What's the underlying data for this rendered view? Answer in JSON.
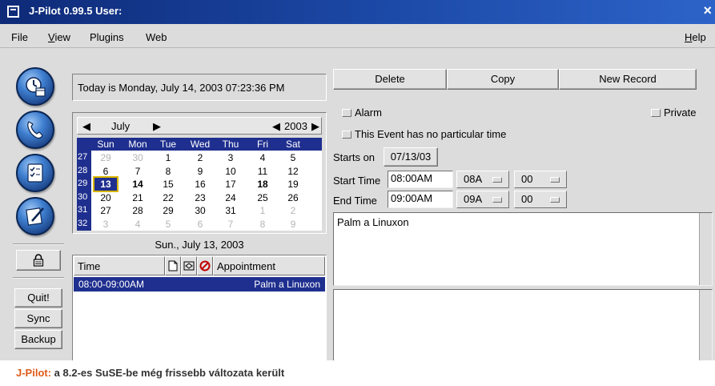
{
  "window": {
    "title": "J-Pilot 0.99.5 User:",
    "close_glyph": "×"
  },
  "menu": {
    "file": "File",
    "view": "View",
    "plugins": "Plugins",
    "web": "Web",
    "help": "Help"
  },
  "sidebar": {
    "icons": [
      "datebook-icon",
      "address-icon",
      "todo-icon",
      "memo-icon"
    ],
    "lock_icon": "lock-icon",
    "buttons": {
      "quit": "Quit!",
      "sync": "Sync",
      "backup": "Backup"
    }
  },
  "calendar": {
    "today_text": "Today is Monday, July 14, 2003 07:23:36 PM",
    "month": "July",
    "year": "2003",
    "prev_month": "◀",
    "next_month": "▶",
    "prev_year": "◀",
    "next_year": "▶",
    "weekdays": [
      "Sun",
      "Mon",
      "Tue",
      "Wed",
      "Thu",
      "Fri",
      "Sat"
    ],
    "week_numbers": [
      "27",
      "28",
      "29",
      "30",
      "31",
      "32"
    ],
    "weeks": [
      [
        "29",
        "30",
        "1",
        "2",
        "3",
        "4",
        "5"
      ],
      [
        "6",
        "7",
        "8",
        "9",
        "10",
        "11",
        "12"
      ],
      [
        "13",
        "14",
        "15",
        "16",
        "17",
        "18",
        "19"
      ],
      [
        "20",
        "21",
        "22",
        "23",
        "24",
        "25",
        "26"
      ],
      [
        "27",
        "28",
        "29",
        "30",
        "31",
        "1",
        "2"
      ],
      [
        "3",
        "4",
        "5",
        "6",
        "7",
        "8",
        "9"
      ]
    ],
    "selected_date": "Sun., July 13, 2003"
  },
  "list": {
    "headers": {
      "time": "Time",
      "appointment": "Appointment"
    },
    "rows": [
      {
        "time": "08:00-09:00AM",
        "title": "Palm a Linuxon"
      }
    ]
  },
  "toolbar": {
    "delete": "Delete",
    "copy": "Copy",
    "new_record": "New Record"
  },
  "editor": {
    "alarm": "Alarm",
    "private": "Private",
    "no_time": "This Event has no particular time",
    "starts_on_label": "Starts on",
    "starts_on_value": "07/13/03",
    "start_time_label": "Start Time",
    "start_time_value": "08:00AM",
    "start_hour": "08A",
    "start_min": "00",
    "end_time_label": "End Time",
    "end_time_value": "09:00AM",
    "end_hour": "09A",
    "end_min": "00",
    "description": "Palm a Linuxon",
    "note": ""
  },
  "caption": {
    "brand": "J-Pilot:",
    "text": " a 8.2-es SuSE-be még frissebb változata került"
  }
}
